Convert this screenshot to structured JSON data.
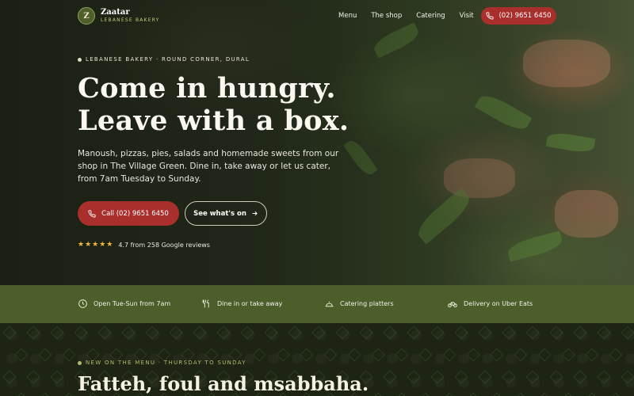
{
  "brand": {
    "initial": "Z",
    "name": "Zaatar",
    "tagline": "LEBANESE BAKERY"
  },
  "nav": {
    "links": [
      "Menu",
      "The shop",
      "Catering",
      "Visit"
    ],
    "call_label": "(02) 9651 6450"
  },
  "hero": {
    "eyebrow": "LEBANESE BAKERY · ROUND CORNER, DURAL",
    "headline_line1": "Come in hungry.",
    "headline_line2": "Leave with a box.",
    "lede": "Manoush, pizzas, pies, salads and homemade sweets from our shop in The Village Green. Dine in, take away or let us cater, from 7am Tuesday to Sunday.",
    "call_button": "Call (02) 9651 6450",
    "secondary_button": "See what's on",
    "rating_stars": "★★★★★",
    "rating_text": "4.7 from 258 Google reviews"
  },
  "features": [
    {
      "icon": "clock-icon",
      "label": "Open Tue-Sun from 7am"
    },
    {
      "icon": "fork-knife-icon",
      "label": "Dine in or take away"
    },
    {
      "icon": "platter-icon",
      "label": "Catering platters"
    },
    {
      "icon": "bicycle-icon",
      "label": "Delivery on Uber Eats"
    }
  ],
  "menu_section": {
    "eyebrow": "NEW ON THE MENU · THURSDAY TO SUNDAY",
    "title": "Fatteh, foul and msabbaha."
  },
  "colors": {
    "accent_red": "#a82f2c",
    "olive_strip": "#4c5e2a",
    "dark_bg": "#1d2413",
    "star": "#f0b93a"
  }
}
